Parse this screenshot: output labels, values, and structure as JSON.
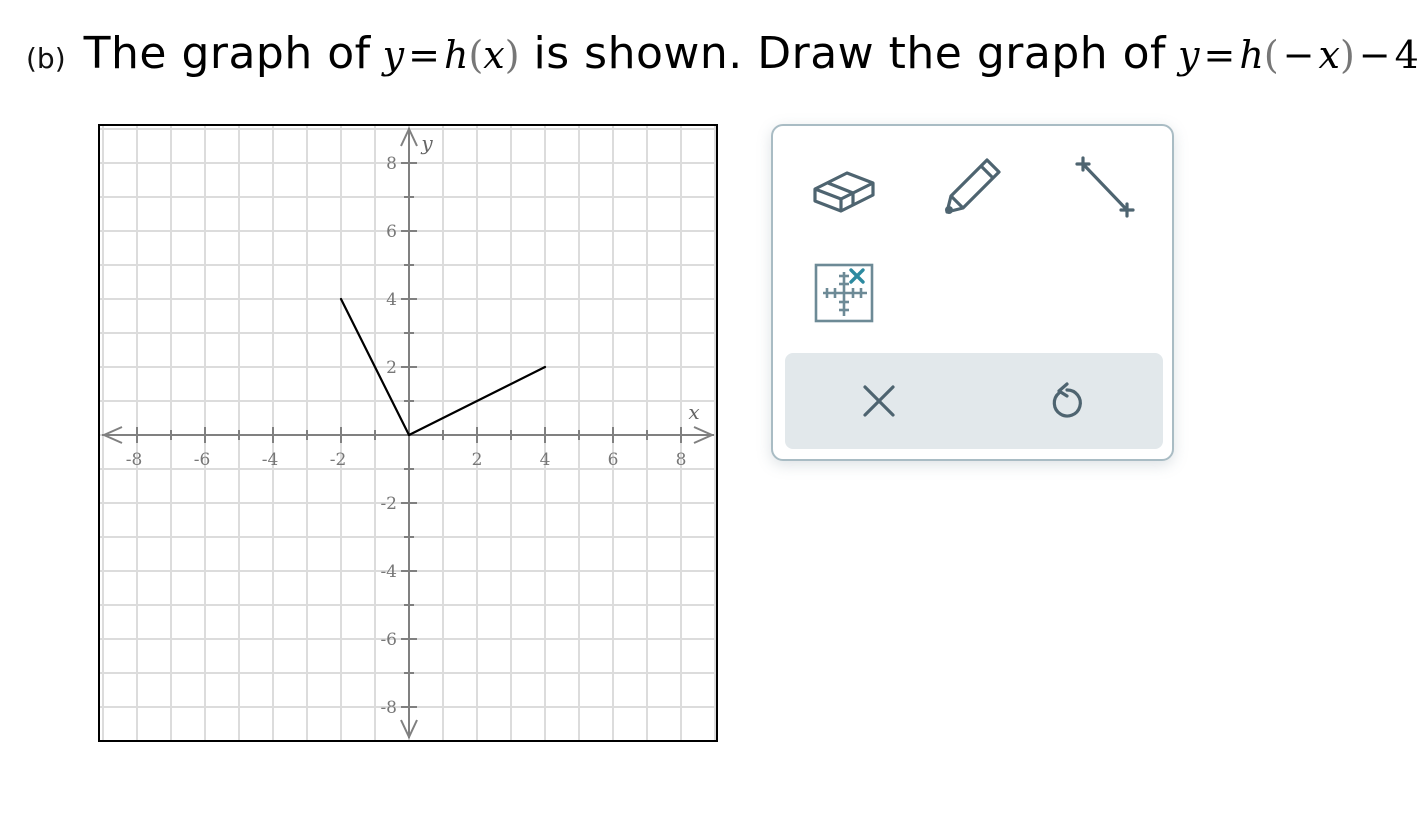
{
  "question": {
    "part_label": "(b)",
    "text_start": "The graph of",
    "text_middle": "is shown. Draw the graph of",
    "text_end": "."
  },
  "graph": {
    "x_axis_label": "x",
    "y_axis_label": "y",
    "x_ticks": [
      "-8",
      "-6",
      "-4",
      "-2",
      "2",
      "4",
      "6",
      "8"
    ],
    "y_ticks": [
      "8",
      "6",
      "4",
      "2",
      "-2",
      "-4",
      "-6",
      "-8"
    ]
  },
  "chart_data": {
    "type": "line",
    "xlabel": "x",
    "ylabel": "y",
    "xlim": [
      -9,
      9
    ],
    "ylim": [
      -9,
      9
    ],
    "grid": true,
    "series": [
      {
        "x": [
          -2,
          0,
          4
        ],
        "y": [
          4,
          0,
          2
        ]
      }
    ]
  },
  "toolbox": {
    "tools": [
      "eraser-icon",
      "pencil-icon",
      "line-segment-icon",
      "point-plot-icon"
    ],
    "actions": [
      "clear-icon",
      "undo-icon"
    ],
    "accent_color": "#2c8aa0",
    "icon_color": "#4e6470"
  }
}
